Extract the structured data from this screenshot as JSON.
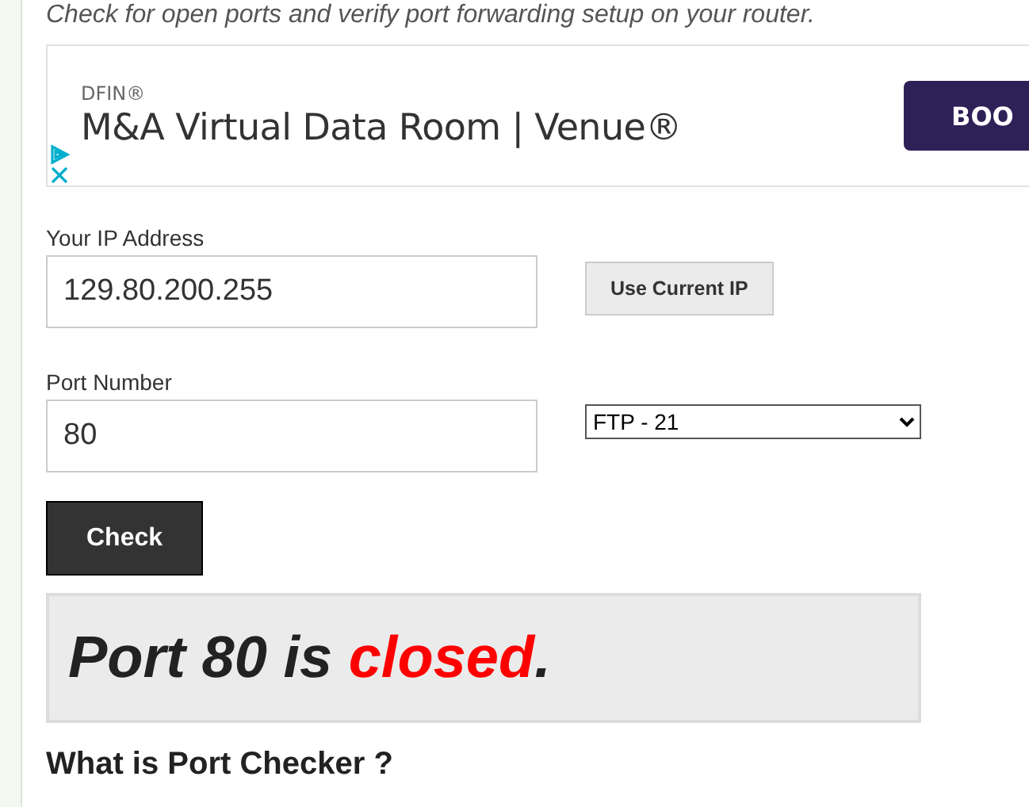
{
  "intro": "Check for open ports and verify port forwarding setup on your router.",
  "ad": {
    "advertiser": "DFIN®",
    "headline": "M&A Virtual Data Room | Venue®",
    "button": "BOO"
  },
  "ip_field": {
    "label": "Your IP Address",
    "value": "129.80.200.255"
  },
  "use_current_button": "Use Current IP",
  "port_field": {
    "label": "Port Number",
    "value": "80"
  },
  "service_select": {
    "value": "FTP - 21"
  },
  "check_button": "Check",
  "result": {
    "prefix": "Port 80 is",
    "status": "closed",
    "suffix": "."
  },
  "next_heading": "What is Port Checker ?"
}
